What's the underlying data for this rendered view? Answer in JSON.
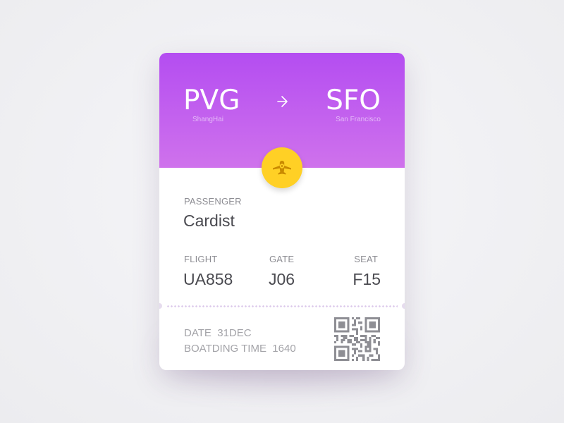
{
  "ticket": {
    "origin": {
      "code": "PVG",
      "city": "ShangHai"
    },
    "destination": {
      "code": "SFO",
      "city": "San Francisco"
    },
    "arrow_icon": "arrow-right-icon",
    "plane_icon": "airplane-icon",
    "passenger": {
      "label": "PASSENGER",
      "value": "Cardist"
    },
    "flight": {
      "label": "FLIGHT",
      "value": "UA858"
    },
    "gate": {
      "label": "GATE",
      "value": "J06"
    },
    "seat": {
      "label": "SEAT",
      "value": "F15"
    },
    "date": {
      "label": "DATE",
      "value": "31DEC"
    },
    "boarding": {
      "label": "BOATDING TIME",
      "value": "1640"
    },
    "qr_icon": "qr-code-icon"
  },
  "colors": {
    "header_top": "#b44df1",
    "header_bottom": "#cf72ec",
    "badge": "#ffd025",
    "label": "#8d8d93",
    "value": "#4a4a50"
  }
}
